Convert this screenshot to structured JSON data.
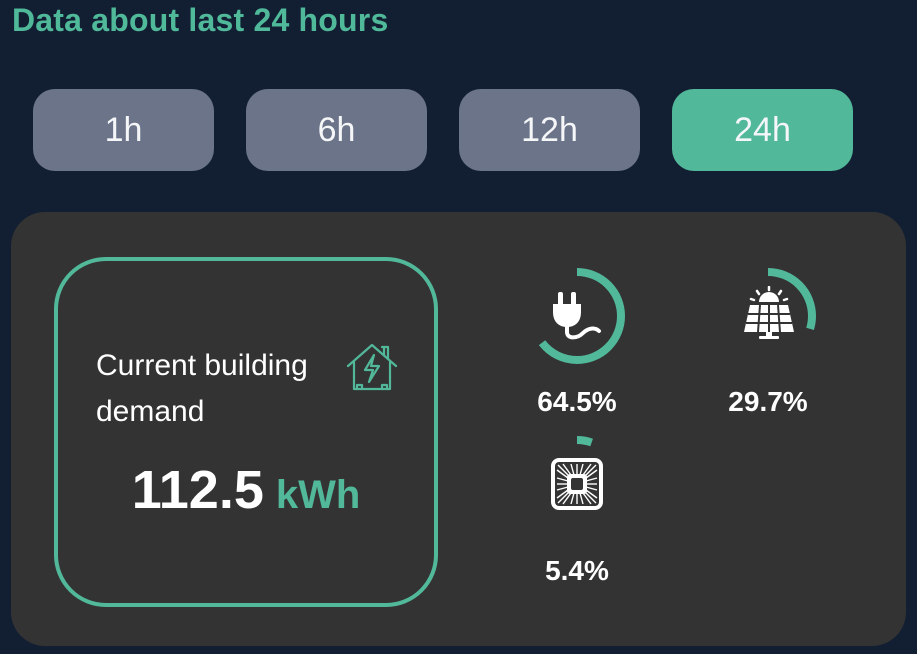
{
  "header": {
    "title": "Data about last 24 hours"
  },
  "tabs": [
    {
      "label": "1h",
      "active": false
    },
    {
      "label": "6h",
      "active": false
    },
    {
      "label": "12h",
      "active": false
    },
    {
      "label": "24h",
      "active": true
    }
  ],
  "demand": {
    "label": "Current building demand",
    "value": "112.5",
    "unit": "kWh",
    "icon": "house-energy-icon"
  },
  "sources": [
    {
      "name": "grid",
      "icon": "plug-icon",
      "percent": 64.5,
      "percent_text": "64.5%"
    },
    {
      "name": "solar",
      "icon": "solar-panel-icon",
      "percent": 29.7,
      "percent_text": "29.7%"
    },
    {
      "name": "other",
      "icon": "heat-unit-icon",
      "percent": 5.4,
      "percent_text": "5.4%"
    }
  ],
  "colors": {
    "accent": "#52b89a",
    "background": "#121f33",
    "card": "#333333",
    "tab_inactive": "#6b7489"
  }
}
